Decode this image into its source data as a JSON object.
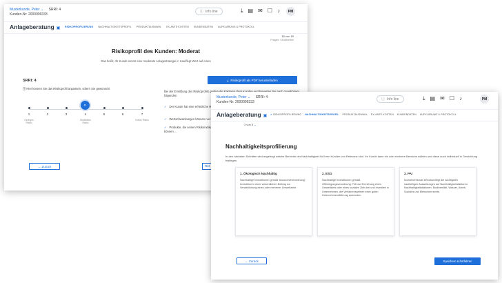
{
  "customer": {
    "name": "Musterkunde, Peter",
    "number": "Kunden-Nr: 2000099333",
    "srri": "SRRI: 4"
  },
  "topbar": {
    "info_label": "Info line",
    "icons": [
      "download-icon",
      "document-icon",
      "mail-icon",
      "chat-icon",
      "bell-icon"
    ],
    "avatar": "PM"
  },
  "nav": {
    "title": "Anlageberatung",
    "tabs": [
      "RISIKOPROFILIERUNG",
      "NACHHALTIGKEITSPROFIL",
      "PRODUKTAUSWAHL",
      "EX-ANTE KOSTEN",
      "KUNDENDATEN",
      "AUFKLÄRUNG & PROTOKOLL"
    ]
  },
  "window1": {
    "paging": "15 von 15",
    "paging_sub": "Fragen / Antworten",
    "heading": "Risikoprofil des Kunden: Moderat",
    "lead": "Das heißt, Ihr Kunde nimmt eine moderate Anlagestrategie in Kauf/legt Wert auf einen",
    "srri_label": "SRRI: 4",
    "pdf_button": "Risikoprofil als PDF herunterladen",
    "adjust_text": "Hier können Sie das Risikoprofil anpassen, sofern Sie gewünscht",
    "slider": {
      "ticks": [
        "1",
        "2",
        "3",
        "4",
        "5",
        "6",
        "7"
      ],
      "selected": 4,
      "tick_subs": [
        "Geringes Risiko",
        "",
        "",
        "Moderates Risiko",
        "",
        "",
        "Hohes Risiko"
      ]
    },
    "explain": "Bei der Ermittlung des Risikoprofils greifen die Faktoren Ihrer Kunden und bewerten Sie nach zugehöriger folgenden",
    "bullets": [
      "Der Kunde hat eine erhebliche Risikobereitschaft",
      "Wertschwankungen können nur in begrenzter Form",
      "Produkte, die seinen Risikoindikator von über Stufe 3 ... eher, die ... Schwankungen ... Schwankungen können ..."
    ],
    "back_label": "Zurück",
    "next_label": "Ret"
  },
  "window2": {
    "pager": "3 von 5",
    "heading": "Nachhaltigkeitsprofilierung",
    "intro": "In den nächsten Schritten wird angefragt welche Bereiche der Nachhaltigkeit für Ihren Kunden von Relevanz sind. Ihr Kunde kann ein oder mehrere Bereiche wählen und diese auch individuell in Gewichtung festlegen.",
    "cards": [
      {
        "title": "1. Ökologisch Nachhaltig",
        "body": "Nachhaltige Investitionen gemäß Taxonomieverordnung: Investition in einer wesentlichen Beitrag zur Verwirklichung eines oder mehrerer Umweltziele."
      },
      {
        "title": "2. ESG",
        "body": "Nachhaltige Investitionen gemäß Offenlegungsverordnung: Tritt zur Erreichung eines Umweltziels oder eines sozialen Ziels bei und investiert in Unternehmen, die Verfahrensweisen einer guten Unternehmensführung anwenden."
      },
      {
        "title": "3. PAI",
        "body": "Investmentfonds berücksichtigt die wichtigsten nachteiligen Auswirkungen auf Nachhaltigkeitsfaktoren. Nachhaltigkeitsfaktoren: Biodiversität, Wasser, Arbeit, Soziales und Menschenrechte."
      }
    ],
    "back_label": "Zurück",
    "save_label": "Speichern & fortfahren"
  },
  "colors": {
    "accent": "#1e6fd9",
    "text": "#222222"
  }
}
